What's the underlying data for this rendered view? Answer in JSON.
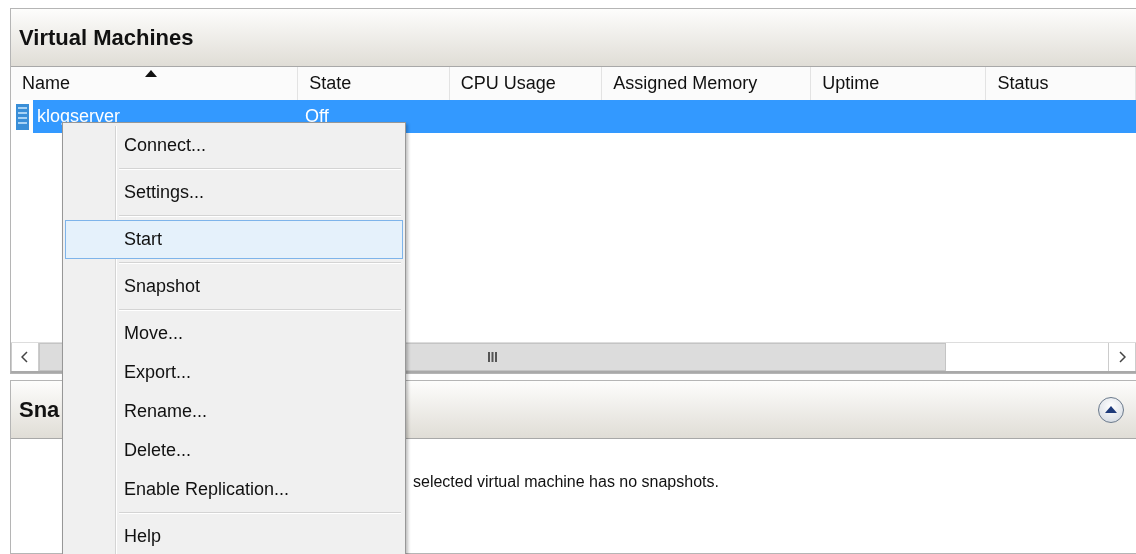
{
  "virtual_machines": {
    "title": "Virtual Machines",
    "columns": [
      {
        "label": "Name",
        "sorted": true
      },
      {
        "label": "State",
        "sorted": false
      },
      {
        "label": "CPU Usage",
        "sorted": false
      },
      {
        "label": "Assigned Memory",
        "sorted": false
      },
      {
        "label": "Uptime",
        "sorted": false
      },
      {
        "label": "Status",
        "sorted": false
      }
    ],
    "rows": [
      {
        "name": "klogserver",
        "state": "Off",
        "selected": true
      }
    ]
  },
  "snapshots": {
    "title": "Sna",
    "message": "selected virtual machine has no snapshots."
  },
  "context_menu": {
    "groups": [
      [
        {
          "label": "Connect...",
          "selected": false
        }
      ],
      [
        {
          "label": "Settings...",
          "selected": false
        }
      ],
      [
        {
          "label": "Start",
          "selected": true
        }
      ],
      [
        {
          "label": "Snapshot",
          "selected": false
        }
      ],
      [
        {
          "label": "Move...",
          "selected": false
        },
        {
          "label": "Export...",
          "selected": false
        },
        {
          "label": "Rename...",
          "selected": false
        },
        {
          "label": "Delete...",
          "selected": false
        },
        {
          "label": "Enable Replication...",
          "selected": false
        }
      ],
      [
        {
          "label": "Help",
          "selected": false
        }
      ]
    ]
  }
}
